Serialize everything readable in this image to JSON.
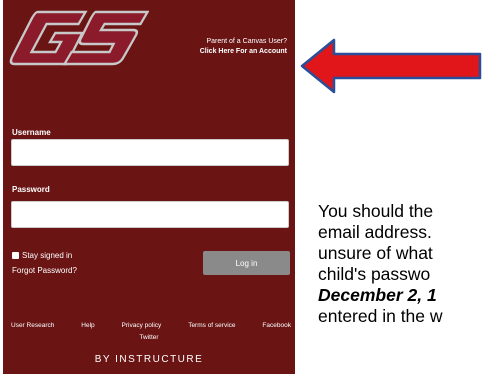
{
  "header": {
    "logo_text": "GS",
    "parent_question": "Parent of a Canvas User?",
    "parent_link": "Click Here For an Account"
  },
  "form": {
    "username_label": "Username",
    "password_label": "Password",
    "stay_signed_in": "Stay signed in",
    "forgot_password": "Forgot Password?",
    "login_button": "Log in"
  },
  "footer": {
    "links": [
      "User Research",
      "Help",
      "Privacy policy",
      "Terms of service",
      "Facebook"
    ],
    "twitter": "Twitter",
    "by_instructure": "BY INSTRUCTURE"
  },
  "instructions": {
    "line1": "You should the",
    "line2": "email address.",
    "line3": "unsure of what",
    "line4": "child's passwo",
    "line5": "December 2, 1",
    "line6": "entered in the w"
  },
  "colors": {
    "panel": "#6a1414",
    "arrow": "#e0161b",
    "button": "#8a8a8a"
  }
}
